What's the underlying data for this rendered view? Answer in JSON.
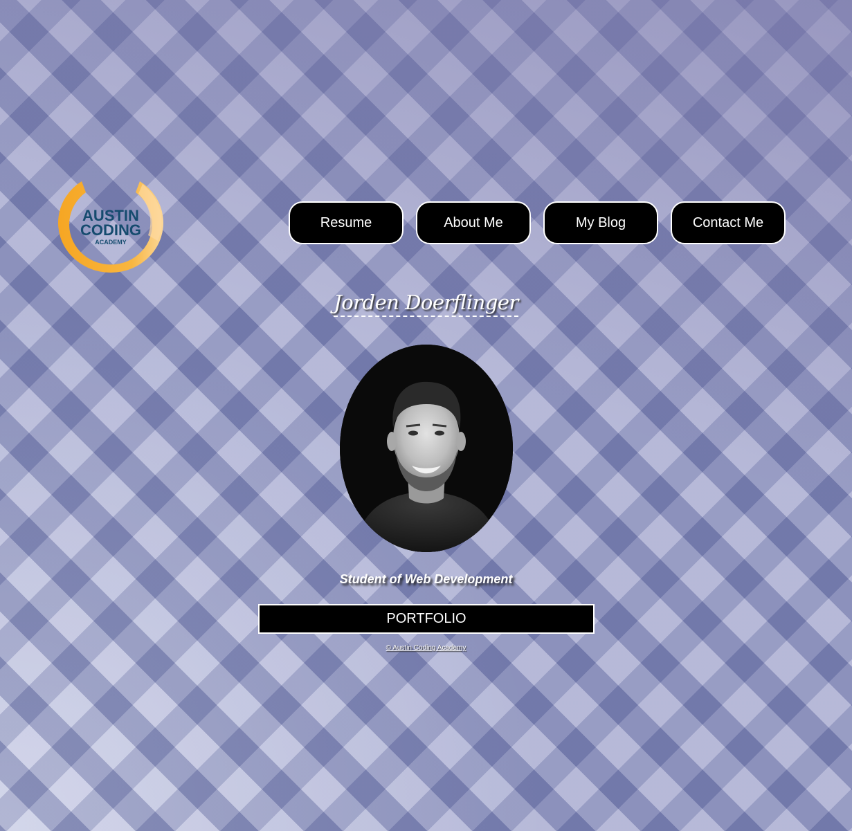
{
  "logo": {
    "line1": "AUSTIN",
    "line2": "CODING",
    "line3": "ACADEMY",
    "ring_color": "#f5a823",
    "text_color": "#154b6e"
  },
  "nav": {
    "items": [
      {
        "label": "Resume"
      },
      {
        "label": "About Me"
      },
      {
        "label": "My Blog"
      },
      {
        "label": "Contact Me"
      }
    ]
  },
  "profile": {
    "name": "Jorden Doerflinger",
    "subtitle": "Student of Web Development"
  },
  "portfolio": {
    "label": "PORTFOLIO"
  },
  "footer": {
    "copyright": "© Austin Coding Academy"
  },
  "colors": {
    "background": "#9fa3cc",
    "button_bg": "#000000",
    "button_text": "#ffffff"
  }
}
